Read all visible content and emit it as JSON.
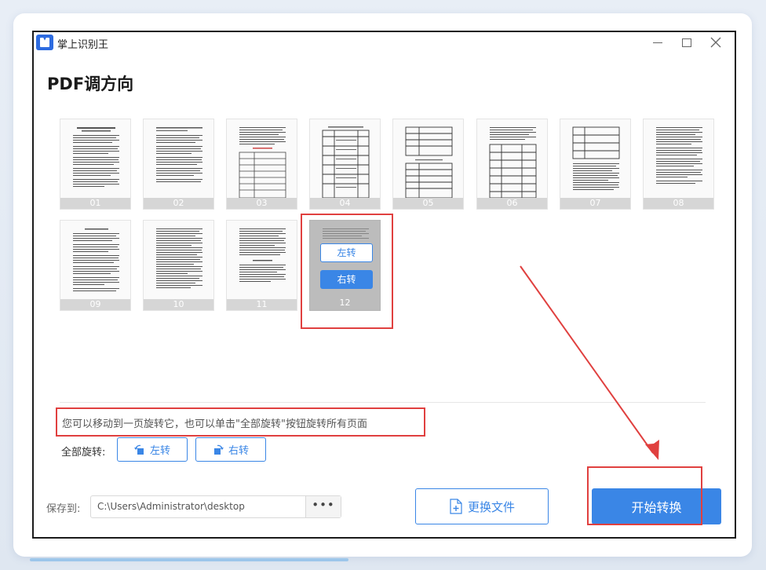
{
  "app": {
    "title": "掌上识别王"
  },
  "page": {
    "title": "PDF调方向"
  },
  "thumbnails": [
    {
      "label": "01"
    },
    {
      "label": "02"
    },
    {
      "label": "03"
    },
    {
      "label": "04"
    },
    {
      "label": "05"
    },
    {
      "label": "06"
    },
    {
      "label": "07"
    },
    {
      "label": "08"
    },
    {
      "label": "09"
    },
    {
      "label": "10"
    },
    {
      "label": "11"
    },
    {
      "label": "12"
    }
  ],
  "active_thumb": {
    "rotate_left_label": "左转",
    "rotate_right_label": "右转"
  },
  "hint": "您可以移动到一页旋转它，也可以单击\"全部旋转\"按钮旋转所有页面",
  "rotate_all": {
    "label": "全部旋转:",
    "left_label": "左转",
    "right_label": "右转"
  },
  "save": {
    "label": "保存到:",
    "path": "C:\\Users\\Administrator\\desktop",
    "more_label": "•••"
  },
  "actions": {
    "change_file_label": "更换文件",
    "start_label": "开始转换"
  },
  "colors": {
    "accent": "#3a86e6",
    "annotation": "#e0403f"
  }
}
